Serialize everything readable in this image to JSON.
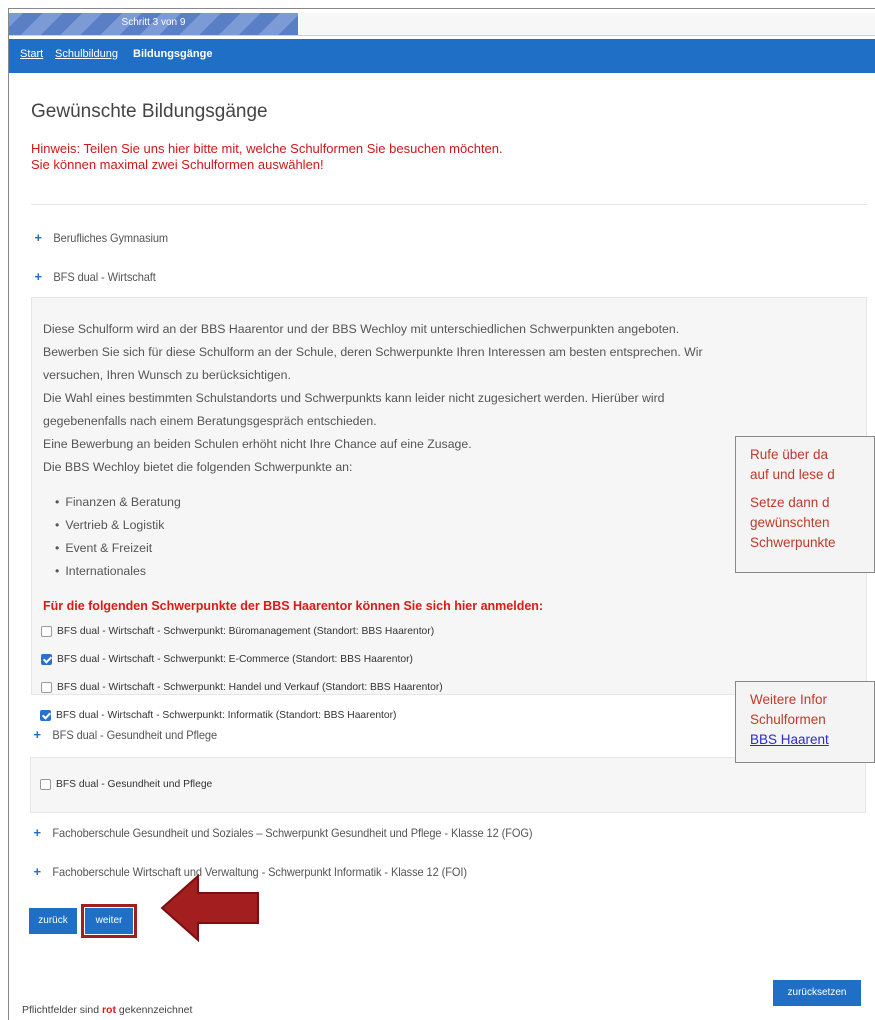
{
  "progress": {
    "label": "Schritt 3 von 9",
    "fraction": 0.333
  },
  "breadcrumb": {
    "start": "Start",
    "schulbildung": "Schulbildung",
    "current": "Bildungsgänge"
  },
  "page_title": "Gewünschte Bildungsgänge",
  "hint": {
    "line1": "Hinweis: Teilen Sie uns hier bitte mit, welche Schulformen Sie besuchen möchten.",
    "line2": "Sie können maximal zwei Schulformen auswählen!"
  },
  "accordion": [
    {
      "label": "Berufliches Gymnasium"
    },
    {
      "label": "BFS dual - Wirtschaft"
    },
    {
      "label": "BFS dual - Gesundheit und Pflege"
    },
    {
      "label": "Fachoberschule Gesundheit und Soziales – Schwerpunkt Gesundheit und Pflege - Klasse 12 (FOG)"
    },
    {
      "label": "Fachoberschule Wirtschaft und Verwaltung - Schwerpunkt Informatik - Klasse 12 (FOI)"
    }
  ],
  "wirtschaft_panel": {
    "paragraph_lines": [
      "Diese Schulform wird an der BBS Haarentor und der BBS Wechloy mit unterschiedlichen Schwerpunkten angeboten.",
      "Bewerben Sie sich für diese Schulform an der Schule, deren Schwerpunkte Ihren Interessen am besten entsprechen. Wir",
      "versuchen, Ihren Wunsch zu berücksichtigen.",
      "Die Wahl eines bestimmten Schulstandorts und Schwerpunkts kann leider nicht zugesichert werden. Hierüber wird",
      "gegebenenfalls nach einem Beratungsgespräch entschieden.",
      "Eine Bewerbung an beiden Schulen erhöht nicht Ihre Chance auf eine Zusage.",
      "Die BBS Wechloy bietet die folgenden Schwerpunkte an:"
    ],
    "bullets": [
      "Finanzen & Beratung",
      "Vertrieb & Logistik",
      "Event & Freizeit",
      "Internationales"
    ],
    "heading": "Für die folgenden Schwerpunkte der BBS Haarentor können Sie sich hier anmelden:",
    "options": [
      {
        "label": "BFS dual - Wirtschaft - Schwerpunkt: Büromanagement (Standort: BBS Haarentor)",
        "checked": false
      },
      {
        "label": "BFS dual - Wirtschaft - Schwerpunkt: E-Commerce (Standort: BBS Haarentor)",
        "checked": true
      },
      {
        "label": "BFS dual - Wirtschaft - Schwerpunkt: Handel und Verkauf (Standort: BBS Haarentor)",
        "checked": false
      },
      {
        "label": "BFS dual - Wirtschaft - Schwerpunkt: Informatik (Standort: BBS Haarentor)",
        "checked": true
      }
    ]
  },
  "gesundheit_panel": {
    "options": [
      {
        "label": "BFS dual - Gesundheit und Pflege",
        "checked": false
      }
    ]
  },
  "buttons": {
    "back": "zurück",
    "next": "weiter",
    "reset": "zurücksetzen"
  },
  "footer": {
    "before": "Pflichtfelder sind ",
    "highlight": "rot",
    "after": " gekennzeichnet"
  },
  "callout1": {
    "line1": "Rufe über da",
    "line2": "auf und lese d",
    "line3": "Setze dann d",
    "line4": "gewünschten",
    "line5": "Schwerpunkte"
  },
  "callout2": {
    "line1": "Weitere Infor",
    "line2": "Schulformen",
    "link": "BBS Haarent"
  },
  "colors": {
    "primary": "#1f6fc6",
    "hint_red": "#d01818",
    "arrow": "#a31e1e",
    "checkbox": "#2b6fd0"
  }
}
